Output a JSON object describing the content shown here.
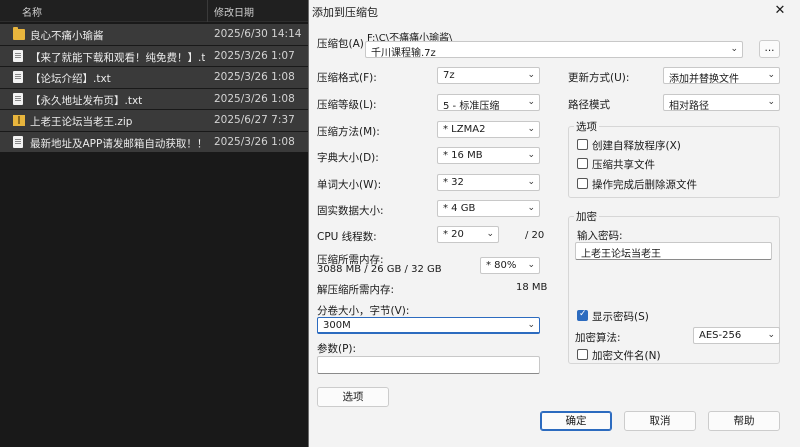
{
  "explorer": {
    "col_name": "名称",
    "col_date": "修改日期",
    "rows": [
      {
        "icon": "folder-icon",
        "name": "良心不痛小瑜酱",
        "date": "2025/6/30 14:14"
      },
      {
        "icon": "file-icon",
        "name": "【来了就能下载和观看！纯免费！】.txt",
        "date": "2025/3/26 1:07"
      },
      {
        "icon": "file-icon",
        "name": "【论坛介绍】.txt",
        "date": "2025/3/26 1:08"
      },
      {
        "icon": "file-icon",
        "name": "【永久地址发布页】.txt",
        "date": "2025/3/26 1:08"
      },
      {
        "icon": "zip-icon",
        "name": "上老王论坛当老王.zip",
        "date": "2025/6/27 7:37"
      },
      {
        "icon": "file-icon",
        "name": "最新地址及APP请发邮箱自动获取！！！....",
        "date": "2025/3/26 1:08"
      }
    ]
  },
  "dialog": {
    "title": "添加到压缩包",
    "close_glyph": "✕",
    "archive_label": "压缩包(A)",
    "archive_path": "F:\\C\\不痛痛小瑜酱\\",
    "archive_name": "千川课程输.7z",
    "browse_label": "...",
    "format_label": "压缩格式(F):",
    "format_value": "7z",
    "level_label": "压缩等级(L):",
    "level_value": "5 - 标准压缩",
    "method_label": "压缩方法(M):",
    "method_value": "*  LZMA2",
    "dict_label": "字典大小(D):",
    "dict_value": "*  16 MB",
    "word_label": "单词大小(W):",
    "word_value": "*  32",
    "solid_label": "固实数据大小:",
    "solid_value": "*  4 GB",
    "cpu_label": "CPU 线程数:",
    "cpu_value": "*  20",
    "cpu_total": "/ 20",
    "mem_comp_label": "压缩所需内存:",
    "mem_comp_value": "3088 MB / 26 GB / 32 GB",
    "mem_percent": "* 80%",
    "mem_decomp_label": "解压缩所需内存:",
    "mem_decomp_value": "18 MB",
    "split_label": "分卷大小，字节(V):",
    "split_value": "300M",
    "params_label": "参数(P):",
    "params_value": "",
    "options_button": "选项",
    "update_label": "更新方式(U):",
    "update_value": "添加并替换文件",
    "path_label": "路径模式",
    "path_value": "相对路径",
    "options_group": "选项",
    "opt_sfx": "创建自释放程序(X)",
    "opt_shared": "压缩共享文件",
    "opt_delete": "操作完成后删除源文件",
    "encrypt_group": "加密",
    "password_label": "输入密码:",
    "password_value": "上老王论坛当老王",
    "show_password": "显示密码(S)",
    "enc_method_label": "加密算法:",
    "enc_method_value": "AES-256",
    "encrypt_names": "加密文件名(N)",
    "ok": "确定",
    "cancel": "取消",
    "help": "帮助"
  }
}
